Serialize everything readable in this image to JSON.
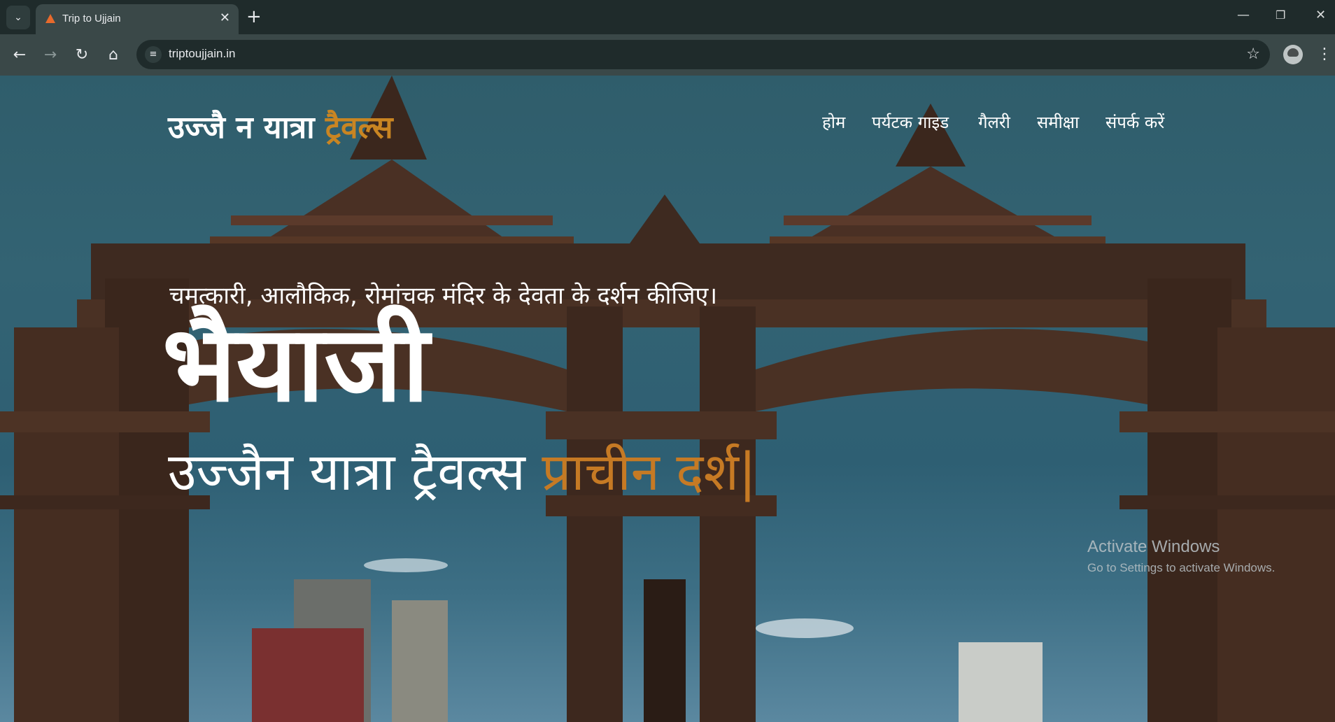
{
  "browser": {
    "tab_title": "Trip to Ujjain",
    "url": "triptoujjain.in"
  },
  "header": {
    "logo_main": "उज्जै न यात्रा",
    "logo_accent": "ट्रैवल्स",
    "nav": [
      {
        "label": "होम"
      },
      {
        "label": "पर्यटक गाइड"
      },
      {
        "label": "गैलरी"
      },
      {
        "label": "समीक्षा"
      },
      {
        "label": "संपर्क करें"
      }
    ]
  },
  "hero": {
    "tagline": "चमत्कारी, आलौकिक, रोमांचक मंदिर के देवता के दर्शन कीजिए।",
    "title": "भैयाजी",
    "subtitle_main": "उज्जैन यात्रा ट्रैवल्स",
    "subtitle_typed": "प्राचीन दर्श",
    "caret": "|"
  },
  "os_watermark": {
    "title": "Activate Windows",
    "subtitle": "Go to Settings to activate Windows."
  },
  "colors": {
    "accent": "#c98522",
    "chrome_dark": "#1f2b2b",
    "chrome_light": "#3a4848"
  }
}
